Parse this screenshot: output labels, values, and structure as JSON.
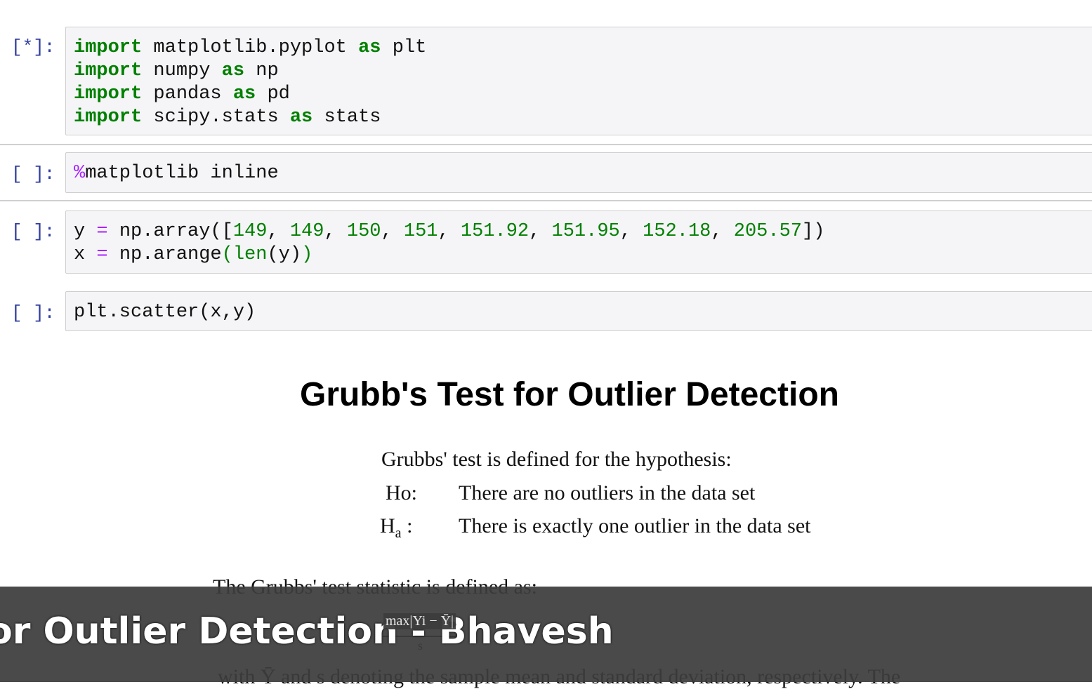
{
  "cells": [
    {
      "prompt": "[*]:",
      "lines": [
        [
          "import",
          "matplotlib.pyplot",
          "as",
          "plt"
        ],
        [
          "import",
          "numpy",
          "as",
          "np"
        ],
        [
          "import",
          "pandas",
          "as",
          "pd"
        ],
        [
          "import",
          "scipy.stats",
          "as",
          "stats"
        ]
      ]
    },
    {
      "prompt": "[ ]:",
      "magic": "%",
      "code": "matplotlib inline"
    },
    {
      "prompt": "[ ]:",
      "line1": {
        "var": "y",
        "eq": "=",
        "fn": "np.array([",
        "nums": [
          "149",
          "149",
          "150",
          "151",
          "151.92",
          "151.95",
          "152.18",
          "205.57"
        ],
        "end": "])"
      },
      "line2": {
        "var": "x",
        "eq": "=",
        "fn": "np.arange",
        "paren_open": "(",
        "inner": "len",
        "inner_args": "(y)",
        "paren_close": ")"
      }
    },
    {
      "prompt": "[ ]:",
      "code": "plt.scatter(x,y)"
    }
  ],
  "markdown": {
    "title": "Grubb's Test for Outlier Detection",
    "intro": "Grubbs' test is defined for the hypothesis:",
    "h0_label": "Ho:",
    "h0_text": "There are no outliers in the data set",
    "ha_label": "H",
    "ha_sub": "a",
    "ha_colon": " :",
    "ha_text": "There is exactly one outlier in the data set",
    "statistic_intro": "The Grubbs' test statistic is defined as:",
    "formula": "max|Yi − Ȳ|",
    "formula_den": "s",
    "with_text": "with Ȳ and s denoting the sample mean and standard deviation, respectively. The"
  },
  "banner": {
    "text": "or Outlier Detection - Bhavesh"
  }
}
